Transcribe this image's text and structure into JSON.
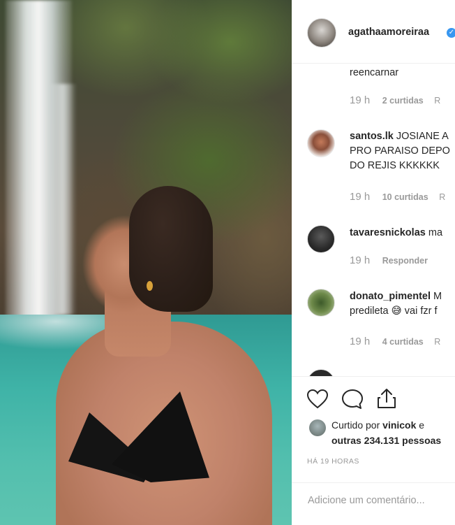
{
  "post": {
    "username": "agathaamoreiraa",
    "verified": true,
    "photo_description_icon": "waterfall-photo"
  },
  "comments": [
    {
      "username": "",
      "text": "reencarnar",
      "time": "19 h",
      "likes": "2 curtidas",
      "reply": "R"
    },
    {
      "username": "santos.lk",
      "text": "JOSIANE A",
      "text2": "PRO PARAISO DEPO",
      "text3": "DO REJIS KKKKKK",
      "time": "19 h",
      "likes": "10 curtidas",
      "reply": "R"
    },
    {
      "username": "tavaresnickolas",
      "text": "ma",
      "time": "19 h",
      "reply": "Responder"
    },
    {
      "username": "donato_pimentel",
      "text": "M",
      "text2": "predileta 😅 vai fzr f",
      "time": "19 h",
      "likes": "4 curtidas",
      "reply": "R"
    }
  ],
  "actions": {
    "like_icon": "heart-icon",
    "comment_icon": "comment-icon",
    "share_icon": "share-icon"
  },
  "liked": {
    "prefix": "Curtido por",
    "user": "vinicok",
    "suffix": "e",
    "others": "outras 234.131 pessoas"
  },
  "timestamp": "HÁ 19 HORAS",
  "add_comment": {
    "placeholder": "Adicione um comentário..."
  },
  "colors": {
    "verified": "#3897f0",
    "meta_text": "#999999",
    "text": "#262626"
  }
}
